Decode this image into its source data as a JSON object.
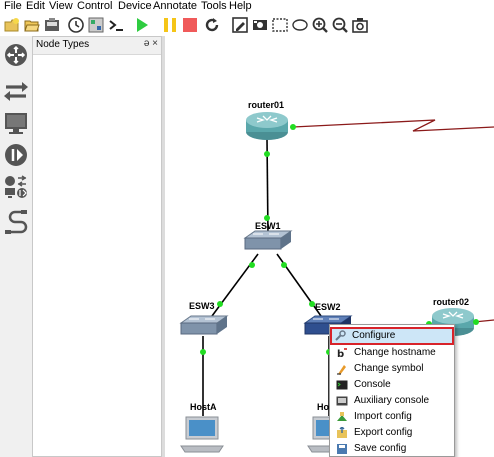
{
  "menubar": {
    "file": "File",
    "edit": "Edit",
    "view": "View",
    "control": "Control",
    "device": "Device",
    "annotate": "Annotate",
    "tools": "Tools",
    "help": "Help"
  },
  "toolbar": {
    "icons": [
      "new-project-icon",
      "open-project-icon",
      "save-project-icon",
      "snapshot-icon",
      "show-interfaces-icon",
      "console-all-icon",
      "start-icon",
      "suspend-icon",
      "stop-icon",
      "reload-icon",
      "add-note-icon",
      "insert-picture-icon",
      "draw-rectangle-icon",
      "draw-ellipse-icon",
      "zoom-in-icon",
      "zoom-out-icon",
      "screenshot-icon"
    ]
  },
  "left_toolbar": {
    "icons": [
      "browse-routers-icon",
      "browse-switches-icon",
      "browse-end-devices-icon",
      "browse-security-devices-icon",
      "browse-all-devices-icon",
      "add-link-icon"
    ]
  },
  "dock": {
    "title": "Node Types",
    "controls": "ə ×"
  },
  "topology": {
    "nodes": {
      "router01": "router01",
      "esw1": "ESW1",
      "esw3": "ESW3",
      "esw2": "ESW2",
      "router02": "router02",
      "hosta": "HostA",
      "hostb": "Ho"
    },
    "colors": {
      "link": "#000000",
      "serial_link": "#8b1a1a",
      "port_up": "#22dd22"
    }
  },
  "context_menu": {
    "items": [
      {
        "label": "Configure",
        "icon": "wrench-icon"
      },
      {
        "label": "Change hostname",
        "icon": "hostname-icon"
      },
      {
        "label": "Change symbol",
        "icon": "symbol-icon"
      },
      {
        "label": "Console",
        "icon": "console-icon"
      },
      {
        "label": "Auxiliary console",
        "icon": "aux-console-icon"
      },
      {
        "label": "Import config",
        "icon": "import-config-icon"
      },
      {
        "label": "Export config",
        "icon": "export-config-icon"
      },
      {
        "label": "Save config",
        "icon": "save-config-icon"
      }
    ],
    "highlight_color": "#d8232a"
  }
}
